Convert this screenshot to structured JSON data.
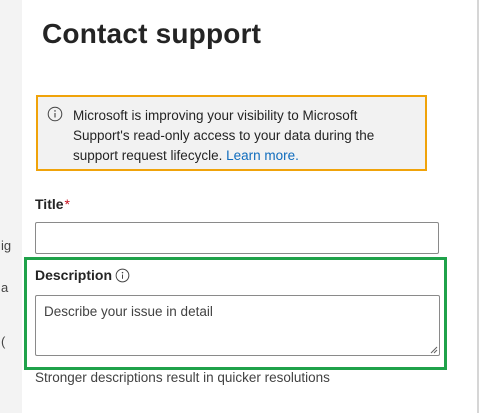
{
  "background": {
    "fragments": [
      "ig",
      "a",
      "("
    ]
  },
  "panel": {
    "title": "Contact support",
    "banner": {
      "text": "Microsoft is improving your visibility to Microsoft Support's read-only access to your data during the support request lifecycle.",
      "link_text": "Learn more.",
      "border_color": "#f0a30a",
      "icon": "info-icon"
    },
    "title_field": {
      "label": "Title",
      "required_marker": "*",
      "value": ""
    },
    "description_field": {
      "label": "Description",
      "placeholder": "Describe your issue in detail",
      "hint": "Stronger descriptions result in quicker resolutions",
      "icon": "info-icon"
    },
    "highlight_color": "#1fa24a",
    "close_icon": "close-icon"
  }
}
